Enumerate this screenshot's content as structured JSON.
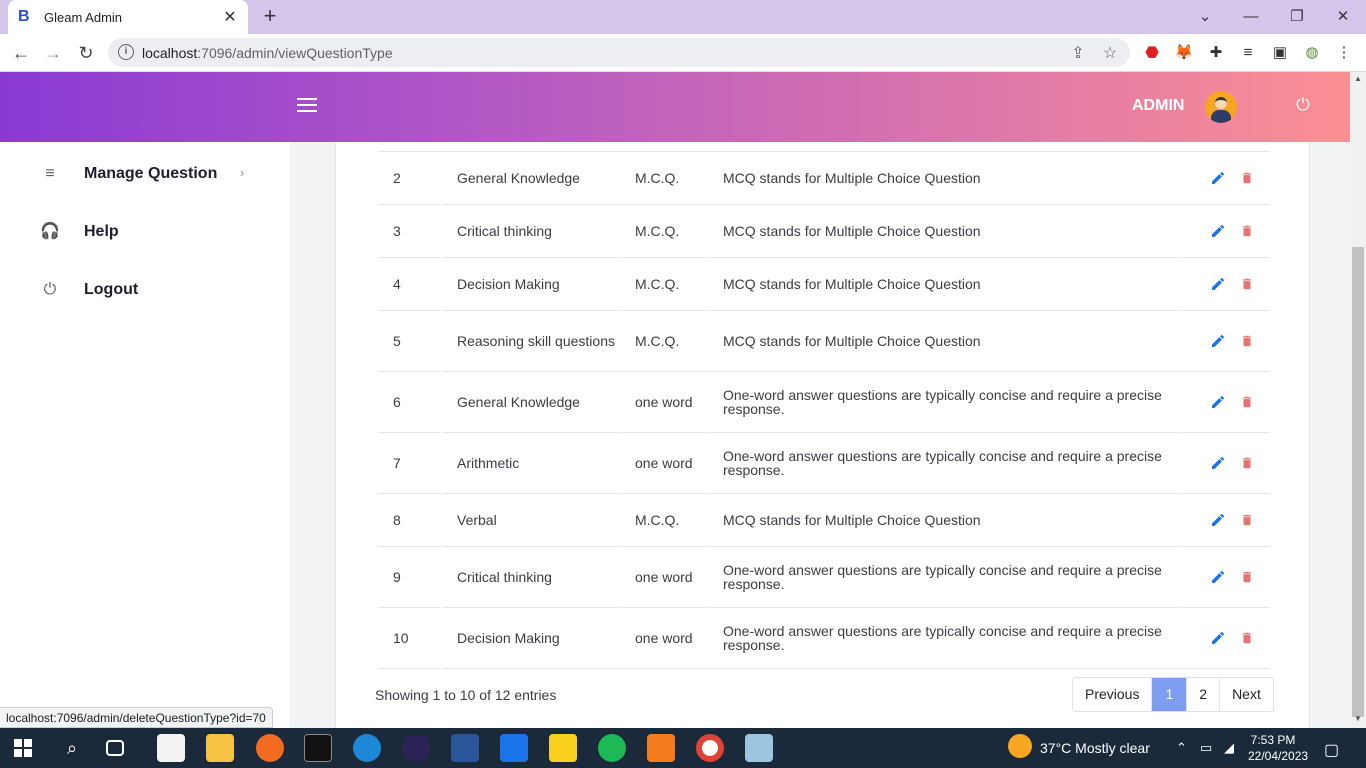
{
  "browser": {
    "tab_title": "Gleam Admin",
    "tab_favicon": "B",
    "url_host": "localhost",
    "url_path": ":7096/admin/viewQuestionType",
    "status_link": "localhost:7096/admin/deleteQuestionType?id=70"
  },
  "header": {
    "admin_label": "ADMIN"
  },
  "sidebar": {
    "items": [
      {
        "label": "Manage Question",
        "icon": "list-icon"
      },
      {
        "label": "Help",
        "icon": "headset-icon"
      },
      {
        "label": "Logout",
        "icon": "power-icon"
      }
    ]
  },
  "table": {
    "rows": [
      {
        "id": "2",
        "name": "General Knowledge",
        "type": "M.C.Q.",
        "description": "MCQ stands for Multiple Choice Question"
      },
      {
        "id": "3",
        "name": "Critical thinking",
        "type": "M.C.Q.",
        "description": "MCQ stands for Multiple Choice Question"
      },
      {
        "id": "4",
        "name": "Decision Making",
        "type": "M.C.Q.",
        "description": "MCQ stands for Multiple Choice Question"
      },
      {
        "id": "5",
        "name": "Reasoning skill questions",
        "type": "M.C.Q.",
        "description": "MCQ stands for Multiple Choice Question"
      },
      {
        "id": "6",
        "name": "General Knowledge",
        "type": "one word",
        "description": "One-word answer questions are typically concise and require a precise response."
      },
      {
        "id": "7",
        "name": "Arithmetic",
        "type": "one word",
        "description": "One-word answer questions are typically concise and require a precise response."
      },
      {
        "id": "8",
        "name": "Verbal",
        "type": "M.C.Q.",
        "description": "MCQ stands for Multiple Choice Question"
      },
      {
        "id": "9",
        "name": "Critical thinking",
        "type": "one word",
        "description": "One-word answer questions are typically concise and require a precise response."
      },
      {
        "id": "10",
        "name": "Decision Making",
        "type": "one word",
        "description": "One-word answer questions are typically concise and require a precise response."
      }
    ],
    "colors": {
      "edit": "#1a73e8",
      "delete": "#e57373"
    }
  },
  "footer": {
    "showing": "Showing 1 to 10 of 12 entries",
    "pagination": {
      "previous": "Previous",
      "pages": [
        "1",
        "2"
      ],
      "active_page": "1",
      "next": "Next"
    }
  },
  "taskbar": {
    "weather": "37°C  Mostly clear",
    "time": "7:53 PM",
    "date": "22/04/2023"
  }
}
